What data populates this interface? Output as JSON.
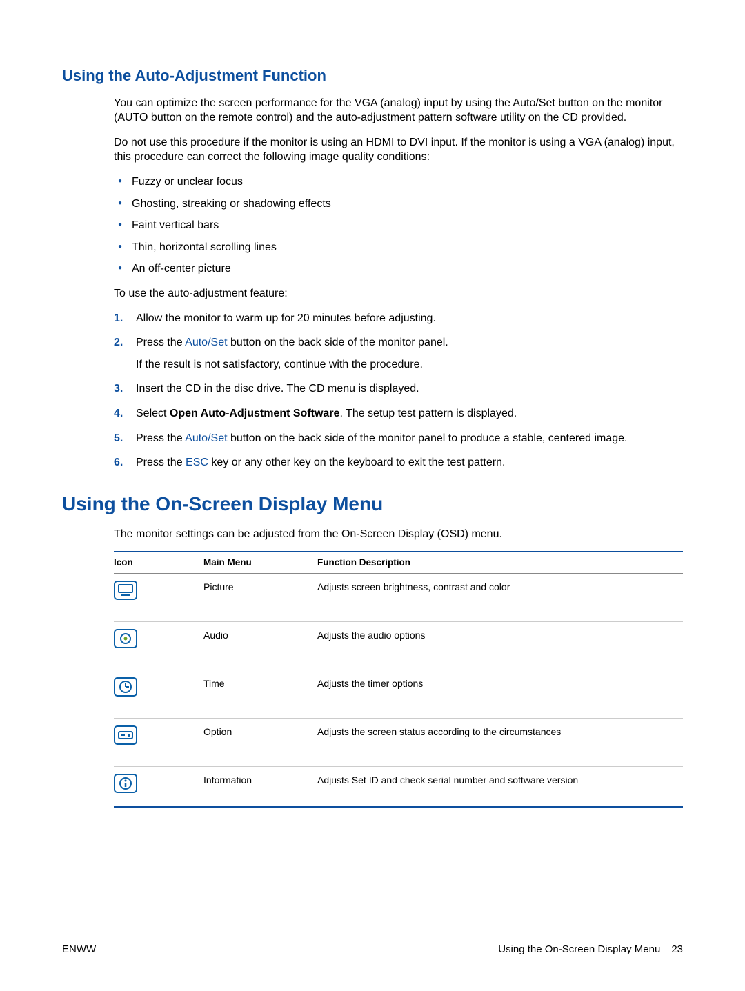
{
  "section1": {
    "heading": "Using the Auto-Adjustment Function",
    "p1": "You can optimize the screen performance for the VGA (analog) input by using the Auto/Set button on the monitor (AUTO button on the remote control) and the auto-adjustment pattern software utility on the CD provided.",
    "p2": "Do not use this procedure if the monitor is using an HDMI to DVI input. If the monitor is using a VGA (analog) input, this procedure can correct the following image quality conditions:",
    "bullets": [
      "Fuzzy or unclear focus",
      "Ghosting, streaking or shadowing effects",
      "Faint vertical bars",
      "Thin, horizontal scrolling lines",
      "An off-center picture"
    ],
    "p3": "To use the auto-adjustment feature:",
    "step1": "Allow the monitor to warm up for 20 minutes before adjusting.",
    "step2_a": "Press the ",
    "step2_b": "Auto/Set",
    "step2_c": " button on the back side of the monitor panel.",
    "step2_sub": "If the result is not satisfactory, continue with the procedure.",
    "step3": "Insert the CD in the disc drive. The CD menu is displayed.",
    "step4_a": "Select ",
    "step4_b": "Open Auto-Adjustment Software",
    "step4_c": ". The setup test pattern is displayed.",
    "step5_a": "Press the ",
    "step5_b": "Auto/Set",
    "step5_c": " button on the back side of the monitor panel to produce a stable, centered image.",
    "step6_a": "Press the ",
    "step6_b": "ESC",
    "step6_c": " key or any other key on the keyboard to exit the test pattern."
  },
  "section2": {
    "heading": "Using the On-Screen Display Menu",
    "p1": "The monitor settings can be adjusted from the On-Screen Display (OSD) menu.",
    "table": {
      "headers": {
        "icon": "Icon",
        "menu": "Main Menu",
        "desc": "Function Description"
      },
      "rows": [
        {
          "menu": "Picture",
          "desc": "Adjusts screen brightness, contrast and color"
        },
        {
          "menu": "Audio",
          "desc": "Adjusts the audio options"
        },
        {
          "menu": "Time",
          "desc": "Adjusts the timer options"
        },
        {
          "menu": "Option",
          "desc": "Adjusts the screen status according to the circumstances"
        },
        {
          "menu": "Information",
          "desc": "Adjusts Set ID and check serial number and software version"
        }
      ]
    }
  },
  "footer": {
    "left": "ENWW",
    "right": "Using the On-Screen Display Menu",
    "page": "23"
  }
}
